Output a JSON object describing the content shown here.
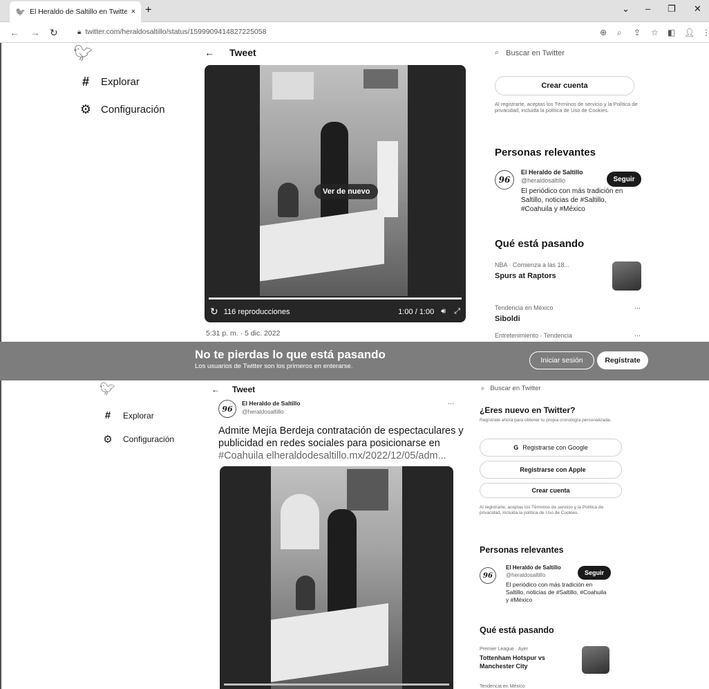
{
  "browser": {
    "tab_title": "El Heraldo de Saltillo en Twitter:",
    "tab_close": "×",
    "new_tab": "+",
    "url": "twitter.com/heraldosaltillo/status/1599909414827225058"
  },
  "top": {
    "nav": {
      "explore": "Explorar",
      "settings": "Configuración"
    },
    "header_title": "Tweet",
    "video": {
      "replay_label": "Ver de nuevo",
      "views": "116 reproducciones",
      "time": "1:00 / 1:00"
    },
    "timestamp": "5:31 p. m. · 5 dic. 2022",
    "search_placeholder": "Buscar en Twitter",
    "create_account": "Crear cuenta",
    "terms_text": "Al registrarte, aceptas los Términos de servicio y la Política de privacidad, incluida la política de Uso de Cookies.",
    "relevant_title": "Personas relevantes",
    "profile": {
      "name": "El Heraldo de Saltillo",
      "handle": "@heraldosaltillo",
      "bio": "El periódico con más tradición en Saltillo, noticias de #Saltillo, #Coahuila y #México",
      "follow": "Seguir"
    },
    "trending_title": "Qué está pasando",
    "trends": [
      {
        "context": "NBA · Comienza a las 18...",
        "title": "Spurs at Raptors"
      },
      {
        "context": "Tendencia en México",
        "title": "Siboldi"
      },
      {
        "context": "Entretenimiento · Tendencia",
        "title": ""
      }
    ]
  },
  "banner": {
    "title": "No te pierdas lo que está pasando",
    "subtitle": "Los usuarios de Twitter son los primeros en enterarse.",
    "login": "Iniciar sesión",
    "signup": "Regístrate"
  },
  "bottom": {
    "nav": {
      "explore": "Explorar",
      "settings": "Configuración"
    },
    "header_title": "Tweet",
    "author": {
      "name": "El Heraldo de Saltillo",
      "handle": "@heraldosaltillo"
    },
    "tweet_text": "Admite Mejía Berdeja contratación de espectaculares y publicidad en redes sociales para posicionarse en",
    "tweet_link": "#Coahuila elheraldodesaltillo.mx/2022/12/05/adm...",
    "search_placeholder": "Buscar en Twitter",
    "new_title": "¿Eres nuevo en Twitter?",
    "new_text": "Regístrate ahora para obtener tu propia cronología personalizada.",
    "google": "Registrarse con Google",
    "apple": "Registrarse con Apple",
    "create_account": "Crear cuenta",
    "terms_text": "Al registrarte, aceptas los Términos de servicio y la Política de privacidad, incluida la política de Uso de Cookies.",
    "relevant_title": "Personas relevantes",
    "profile": {
      "name": "El Heraldo de Saltillo",
      "handle": "@heraldosaltillo",
      "bio": "El periódico con más tradición en Saltillo, noticias de #Saltillo, #Coahuila y #México",
      "follow": "Seguir"
    },
    "trending_title": "Qué está pasando",
    "trends": [
      {
        "context": "Premier League · Ayer",
        "title": "Tottenham Hotspur vs Manchester City"
      },
      {
        "context": "Tendencia en México",
        "title": ""
      }
    ]
  }
}
